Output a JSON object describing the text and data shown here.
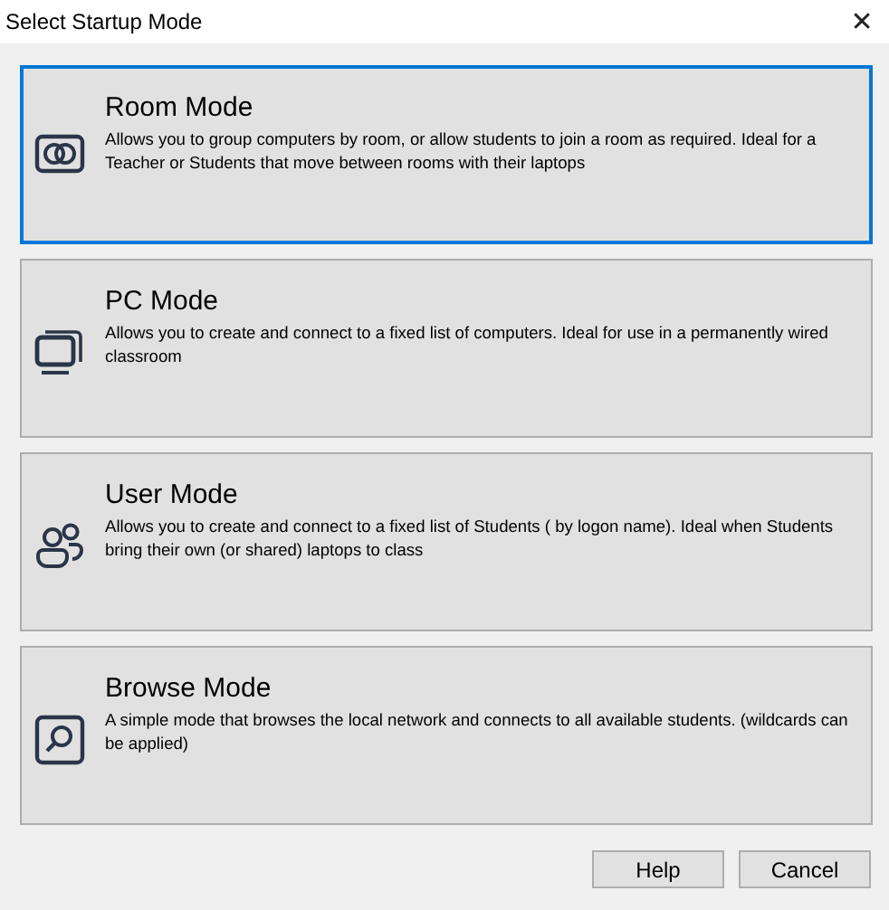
{
  "window": {
    "title": "Select Startup Mode",
    "close": "✕"
  },
  "modes": [
    {
      "kind": "room",
      "title": "Room Mode",
      "description": "Allows you to group computers by room, or allow students to join a room as required. Ideal for a Teacher or Students that move between rooms with their laptops",
      "selected": true
    },
    {
      "kind": "pc",
      "title": "PC Mode",
      "description": "Allows you to create and connect to a fixed list of computers. Ideal for use in a permanently wired classroom",
      "selected": false
    },
    {
      "kind": "user",
      "title": "User Mode",
      "description": "Allows you to create and connect to a fixed list of Students ( by logon name). Ideal when Students bring their own (or shared) laptops to class",
      "selected": false
    },
    {
      "kind": "browse",
      "title": "Browse Mode",
      "description": "A simple mode that browses the local network and connects to all available students. (wildcards can be applied)",
      "selected": false
    }
  ],
  "buttons": [
    "Help",
    "Cancel"
  ]
}
